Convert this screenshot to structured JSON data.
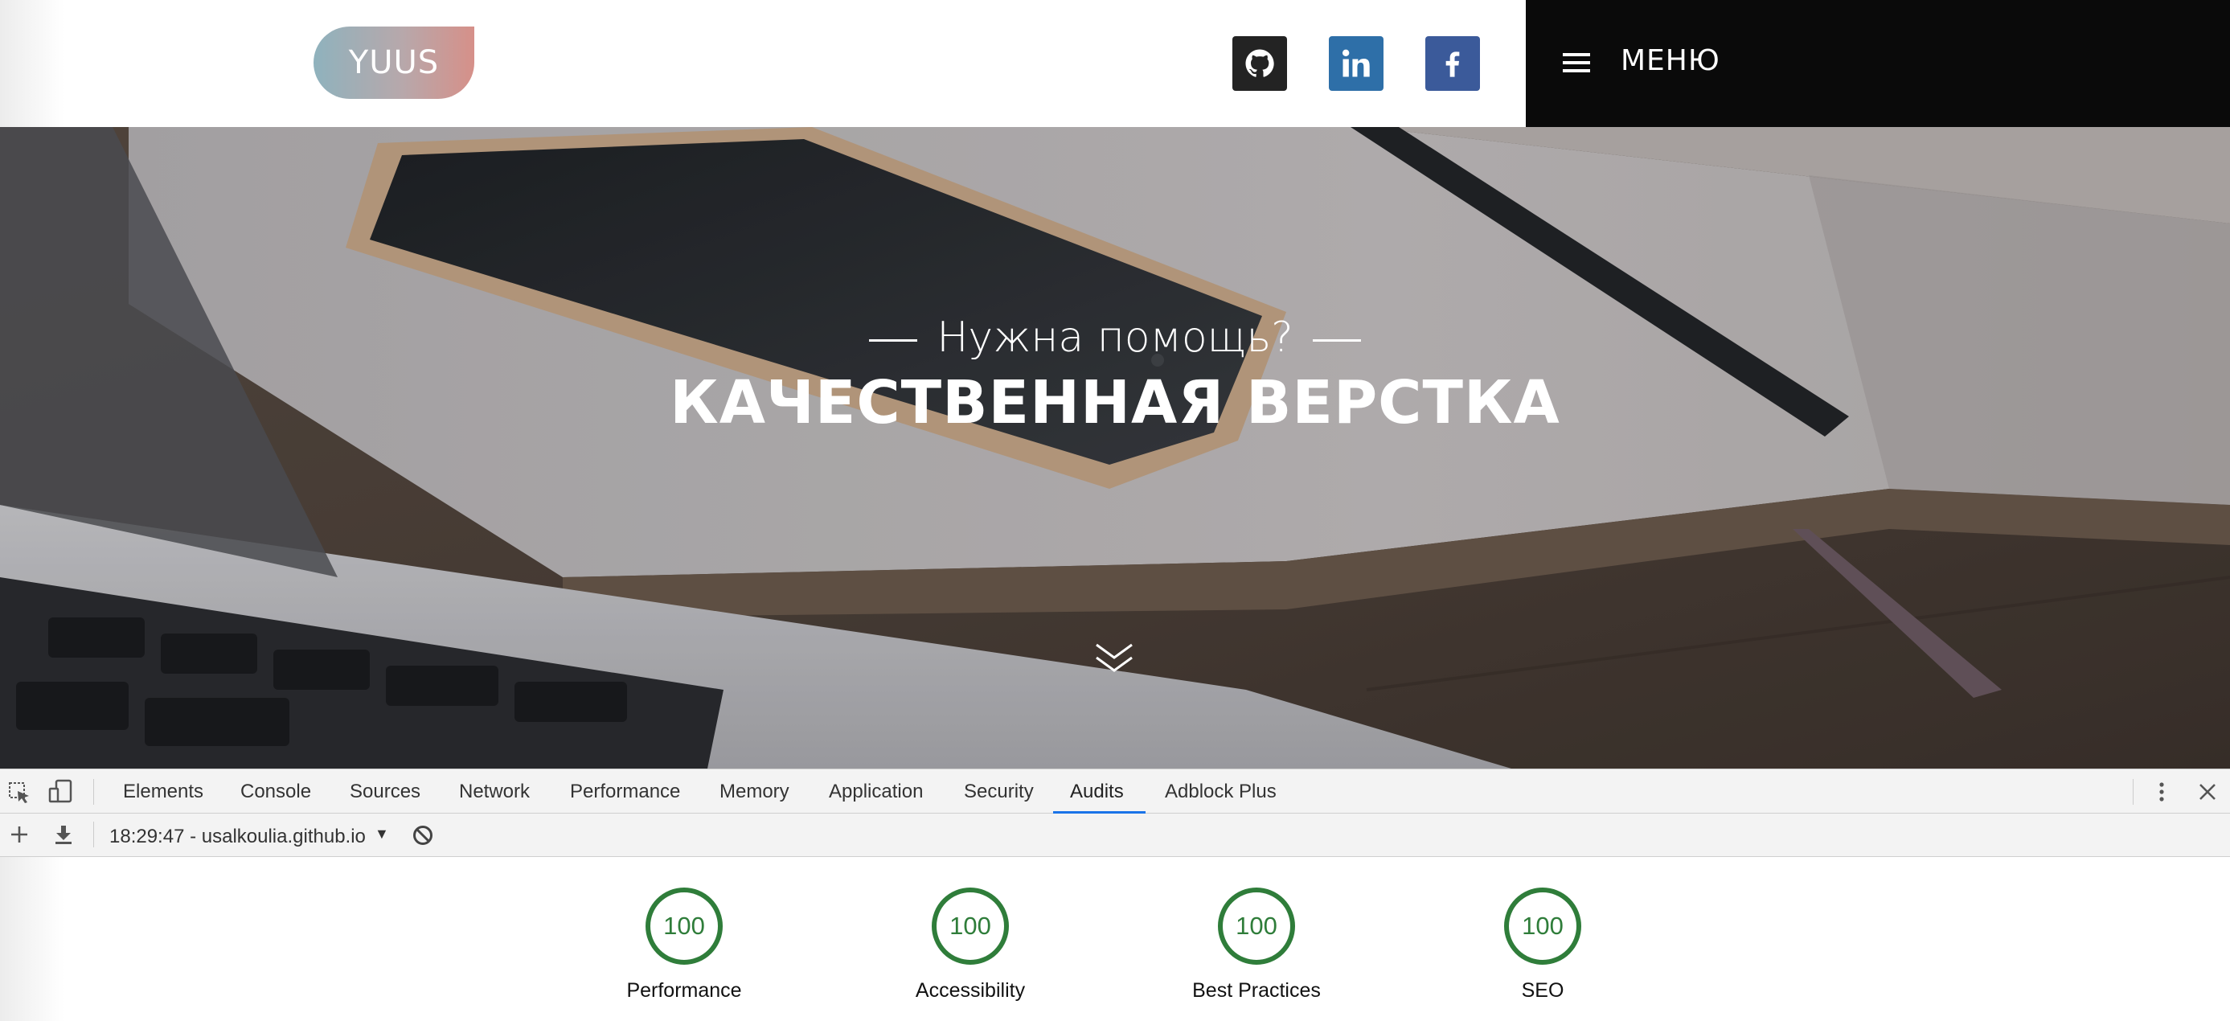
{
  "header": {
    "logo_text": "YUUS",
    "social": [
      {
        "icon": "github-icon",
        "color": "#232323"
      },
      {
        "icon": "linkedin-icon",
        "color": "#2e6fa8"
      },
      {
        "icon": "facebook-icon",
        "color": "#3b5a9a"
      }
    ],
    "menu_label": "МЕНЮ"
  },
  "hero": {
    "subtitle": "Нужна помощь?",
    "title": "КАЧЕСТВЕННАЯ ВЕРСТКА",
    "scroll_icon": "double-chevron-down-icon"
  },
  "devtools": {
    "tabs": [
      "Elements",
      "Console",
      "Sources",
      "Network",
      "Performance",
      "Memory",
      "Application",
      "Security",
      "Audits",
      "Adblock Plus"
    ],
    "active_tab": "Audits",
    "report": "18:29:47 - usalkoulia.github.io",
    "scores": [
      {
        "value": "100",
        "label": "Performance"
      },
      {
        "value": "100",
        "label": "Accessibility"
      },
      {
        "value": "100",
        "label": "Best Practices"
      },
      {
        "value": "100",
        "label": "SEO"
      }
    ],
    "score_color": "#2f7d3a",
    "accent_color": "#1a73e8"
  }
}
